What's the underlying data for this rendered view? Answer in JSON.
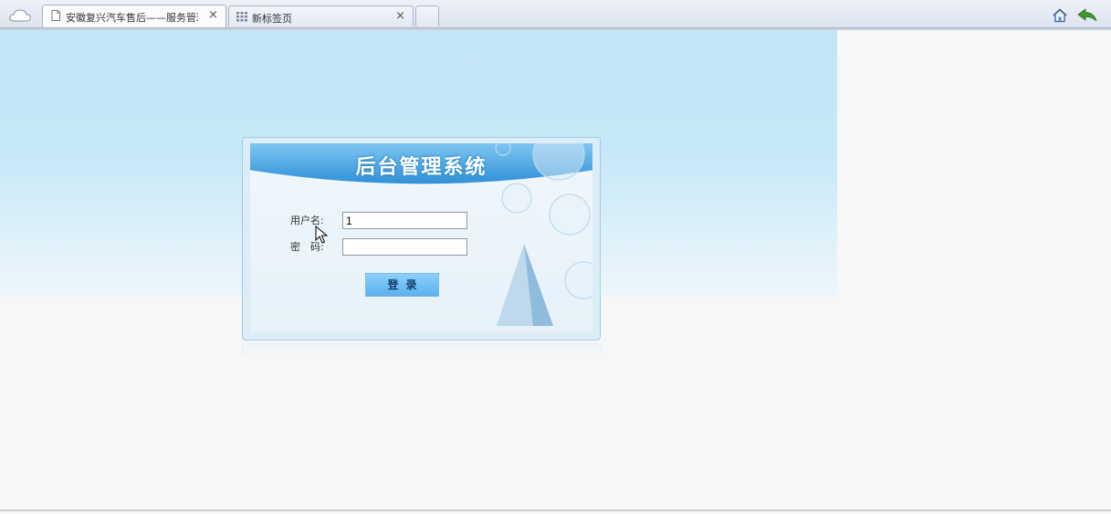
{
  "browser": {
    "tabs": [
      {
        "label": "安徽复兴汽车售后——服务管理",
        "active": true,
        "icon": "page-icon"
      },
      {
        "label": "新标签页",
        "active": false,
        "icon": "grid-icon"
      }
    ],
    "close_glyph": "×"
  },
  "login": {
    "title": "后台管理系统",
    "username_label": "用户名:",
    "password_label": "密　码:",
    "username_value": "1",
    "password_value": "",
    "submit_label": "登录"
  },
  "colors": {
    "sky": "#c3e6f7",
    "banner": "#3a95d6",
    "button": "#6fbff4"
  }
}
